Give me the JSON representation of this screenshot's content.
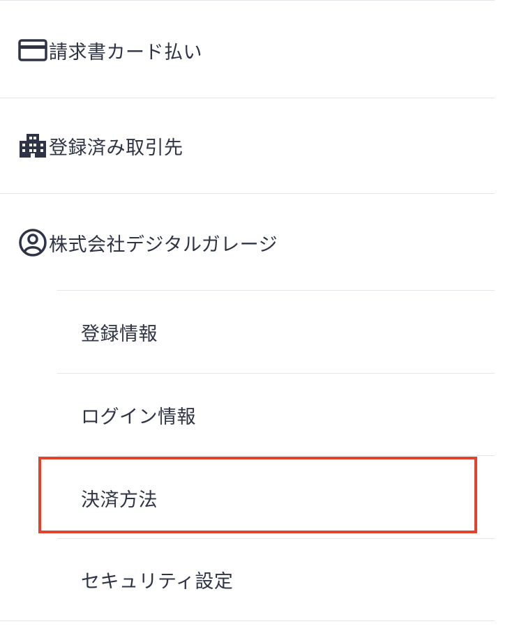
{
  "menu": {
    "items": [
      {
        "label": "請求書カード払い",
        "icon": "credit-card-icon"
      },
      {
        "label": "登録済み取引先",
        "icon": "building-icon"
      },
      {
        "label": "株式会社デジタルガレージ",
        "icon": "user-circle-icon"
      }
    ],
    "subitems": [
      {
        "label": "登録情報"
      },
      {
        "label": "ログイン情報"
      },
      {
        "label": "決済方法",
        "highlighted": true
      },
      {
        "label": "セキュリティ設定"
      }
    ]
  },
  "colors": {
    "text": "#2e3445",
    "divider": "#e3e5ea",
    "highlight_border": "#e1432d"
  }
}
